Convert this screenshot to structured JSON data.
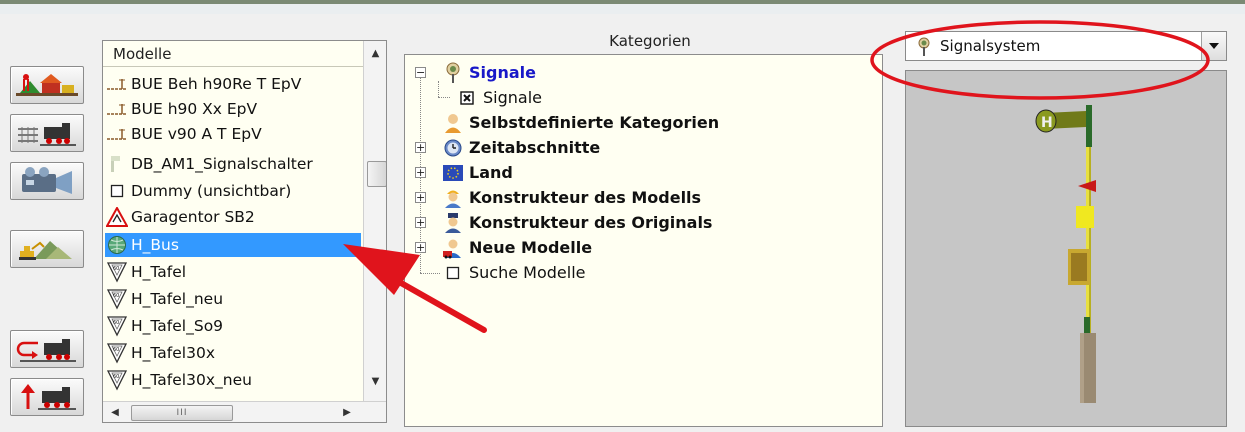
{
  "toolbar": {
    "buttons": [
      {
        "icon": "landscape-train-icon"
      },
      {
        "icon": "track-train-icon"
      },
      {
        "icon": "camera-icon"
      },
      {
        "icon": "excavator-terrain-icon"
      },
      {
        "icon": "return-train-icon"
      },
      {
        "icon": "up-train-icon"
      }
    ]
  },
  "models": {
    "header": "Modelle",
    "items": [
      {
        "label": "BUE Beh h90Re T EpV",
        "icon": "crossing-icon"
      },
      {
        "label": "BUE h90 Xx EpV",
        "icon": "crossing-icon"
      },
      {
        "label": "BUE v90 A T EpV",
        "icon": "crossing-icon"
      },
      {
        "label": "DB_AM1_Signalschalter",
        "icon": "switch-icon"
      },
      {
        "label": "Dummy (unsichtbar)",
        "icon": "checkbox-icon"
      },
      {
        "label": "Garagentor SB2",
        "icon": "warning-sign-icon"
      },
      {
        "label": "H_Bus",
        "icon": "globe-icon",
        "selected": true
      },
      {
        "label": "H_Tafel",
        "icon": "speed-sign-icon"
      },
      {
        "label": "H_Tafel_neu",
        "icon": "speed-sign-icon"
      },
      {
        "label": "H_Tafel_So9",
        "icon": "speed-sign-icon"
      },
      {
        "label": "H_Tafel30x",
        "icon": "speed-sign-icon"
      },
      {
        "label": "H_Tafel30x_neu",
        "icon": "speed-sign-icon"
      }
    ],
    "scroll_thumb_label": "III"
  },
  "categories": {
    "title": "Kategorien",
    "nodes": [
      {
        "label": "Signale",
        "bold": true,
        "color": "#1818c8",
        "expander": "−",
        "icon": "signal-icon"
      },
      {
        "label": "Signale",
        "bold": false,
        "expander": "",
        "icon": "checkbox-checked-icon"
      },
      {
        "label": "Selbstdefinierte Kategorien",
        "bold": true,
        "expander": "",
        "icon": "person-icon"
      },
      {
        "label": "Zeitabschnitte",
        "bold": true,
        "expander": "+",
        "icon": "clock-icon"
      },
      {
        "label": "Land",
        "bold": true,
        "expander": "+",
        "icon": "flag-icon"
      },
      {
        "label": "Konstrukteur des Modells",
        "bold": true,
        "expander": "+",
        "icon": "builder-icon"
      },
      {
        "label": "Konstrukteur des Originals",
        "bold": true,
        "expander": "+",
        "icon": "engineer-icon"
      },
      {
        "label": "Neue Modelle",
        "bold": true,
        "expander": "+",
        "icon": "new-models-icon"
      },
      {
        "label": "Suche Modelle",
        "bold": false,
        "expander": "",
        "icon": "checkbox-icon"
      }
    ]
  },
  "signal_system": {
    "selected": "Signalsystem",
    "icon": "signal-icon"
  },
  "colors": {
    "selection": "#3399ff",
    "list_background": "#fffff2",
    "annotation_red": "#e0141c",
    "tree_highlight": "#1818c8",
    "preview_background": "#c6c6c6"
  }
}
